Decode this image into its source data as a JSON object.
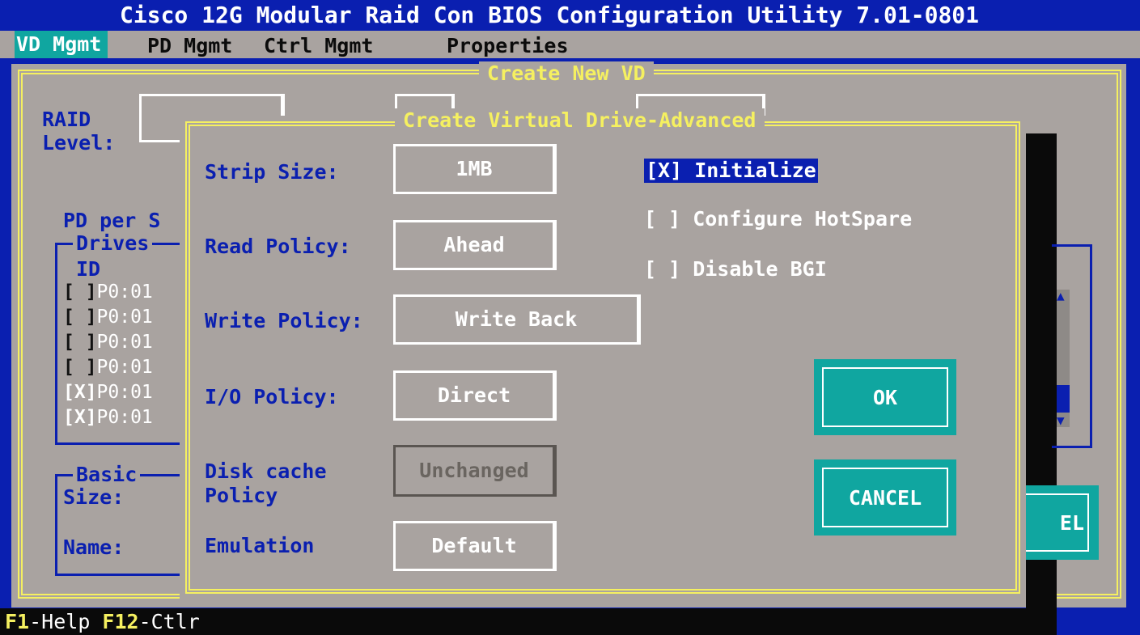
{
  "title": "Cisco 12G Modular Raid Con BIOS Configuration Utility 7.01-0801",
  "menu": [
    "VD Mgmt",
    "PD Mgmt",
    "Ctrl Mgmt",
    "Properties"
  ],
  "outer_dialog": {
    "caption": "Create New VD",
    "raid_label_1": "RAID",
    "raid_label_2": "Level:",
    "pd_per_span": "PD per S",
    "drives_caption": "Drives",
    "id_header": "ID",
    "drive_rows": [
      {
        "check": "[ ]",
        "id": "P0:01"
      },
      {
        "check": "[ ]",
        "id": "P0:01"
      },
      {
        "check": "[ ]",
        "id": "P0:01"
      },
      {
        "check": "[ ]",
        "id": "P0:01"
      },
      {
        "check": "[X]",
        "id": "P0:01"
      },
      {
        "check": "[X]",
        "id": "P0:01"
      }
    ],
    "basic_caption": "Basic",
    "size_label": "Size:",
    "name_label": "Name:",
    "partial_button": "EL"
  },
  "advanced_dialog": {
    "caption": "Create Virtual Drive-Advanced",
    "strip_size": {
      "label": "Strip Size:",
      "value": "1MB"
    },
    "read_policy": {
      "label": "Read Policy:",
      "value": "Ahead"
    },
    "write_policy": {
      "label": "Write Policy:",
      "value": "Write Back"
    },
    "io_policy": {
      "label": "I/O Policy:",
      "value": "Direct"
    },
    "disk_cache": {
      "label_1": "Disk cache",
      "label_2": "Policy",
      "value": "Unchanged"
    },
    "emulation": {
      "label": "Emulation",
      "value": "Default"
    },
    "initialize": "[X] Initialize",
    "configure_hotspare": "[ ] Configure HotSpare",
    "disable_bgi": "[ ] Disable BGI",
    "ok": "OK",
    "cancel": "CANCEL"
  },
  "status_bar": {
    "k1": "F1",
    "t1": "-Help ",
    "k2": "F12",
    "t2": "-Ctlr"
  },
  "colors": {
    "blue": "#0a1fb0",
    "grey": "#a9a3a0",
    "teal": "#10a6a0",
    "yellow": "#f5f060"
  }
}
